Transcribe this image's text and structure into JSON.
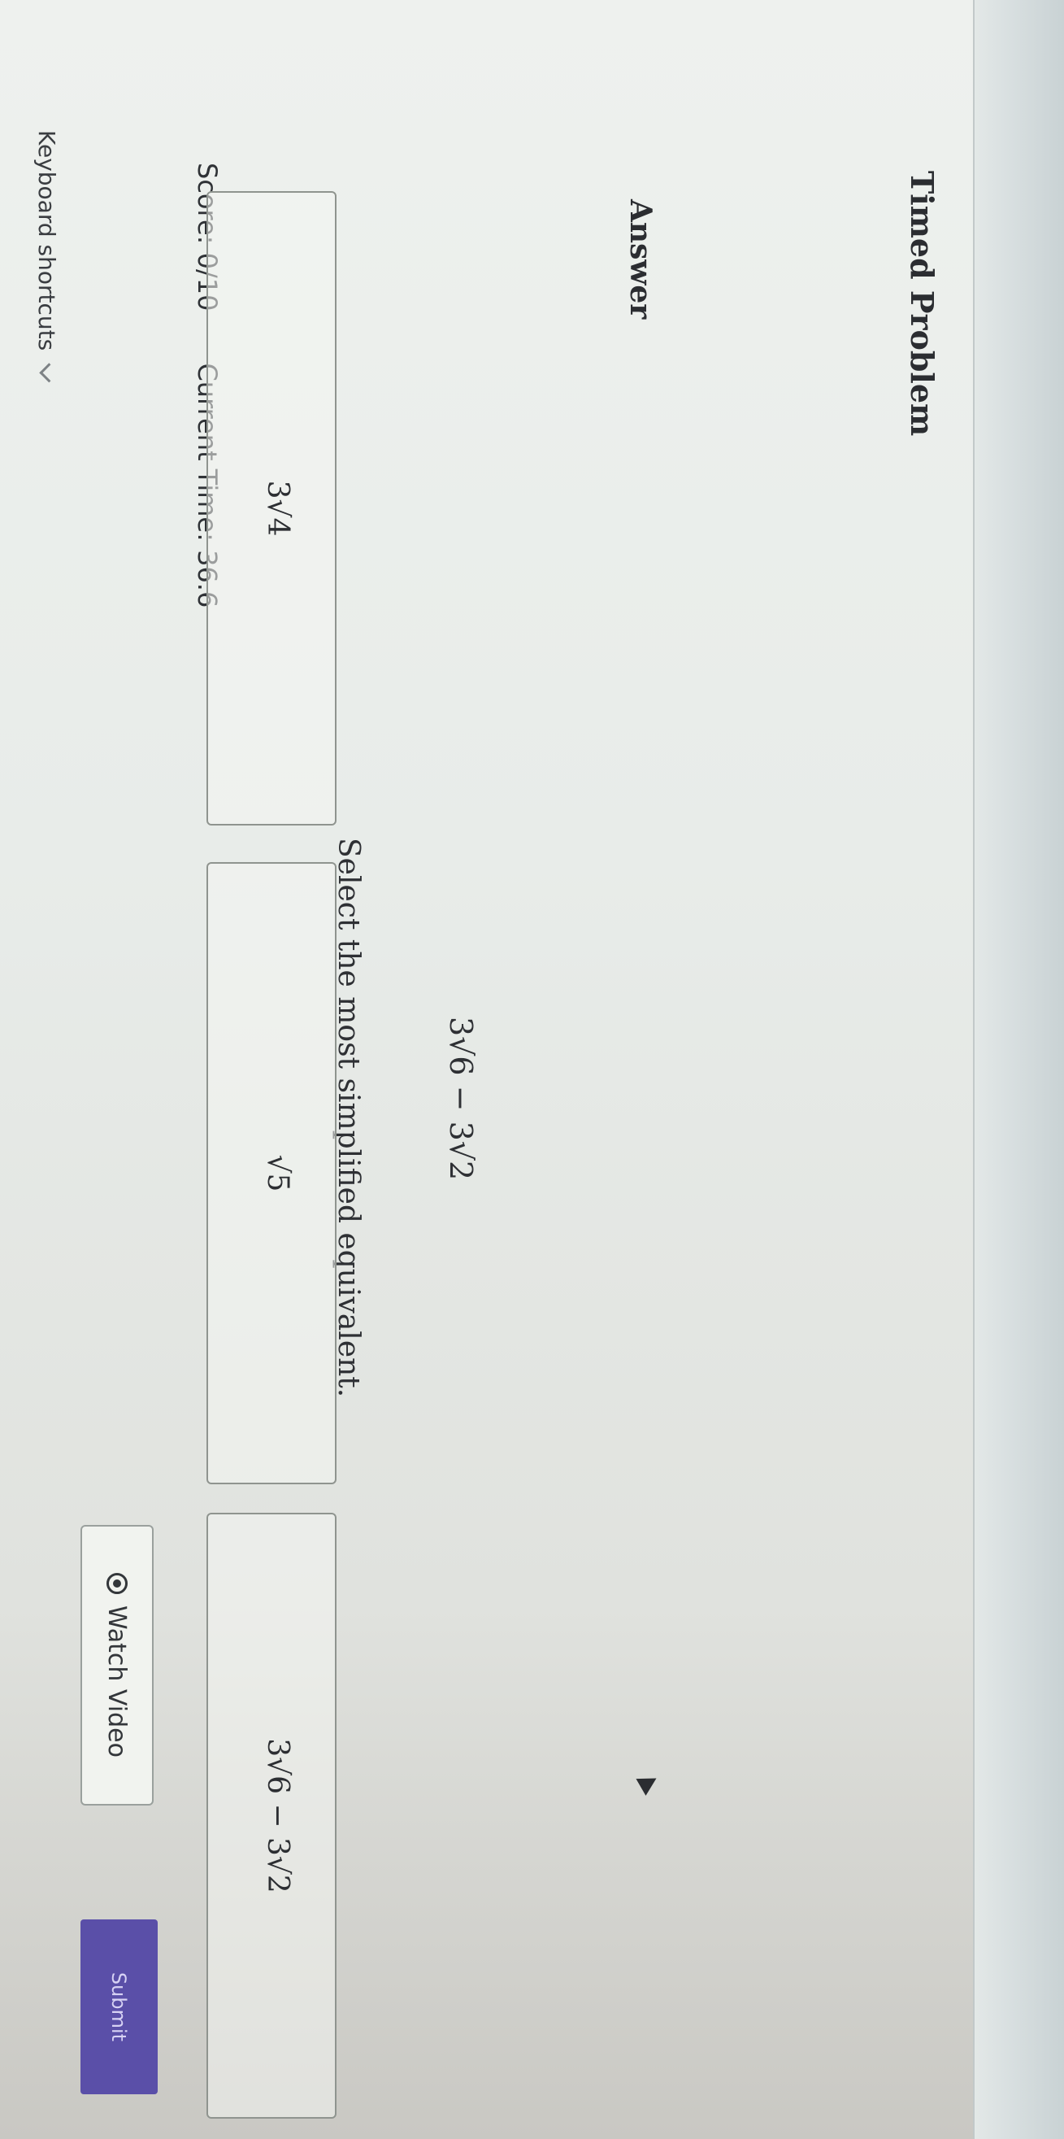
{
  "header": {
    "title": "Timed Problem",
    "watch_video_label": "Watch Video",
    "submit_label": "Submit"
  },
  "status": {
    "score": "Score: 0/10",
    "current_time": "Current Time: 36.6"
  },
  "question": {
    "prompt": "Select the most simplified equivalent.",
    "expression": "3√6 − 3√2"
  },
  "answer": {
    "label": "Answer",
    "choices": [
      {
        "text": "3√4"
      },
      {
        "text": "√5"
      },
      {
        "text": "3√6 − 3√2"
      }
    ]
  },
  "footer": {
    "keyboard_shortcuts": "Keyboard shortcuts"
  },
  "icons": {
    "watch_video": "play-circle-icon",
    "keyboard": "chevron-down-icon"
  },
  "colors": {
    "submit_bg": "#5a4fa8",
    "page_bg": "#e6ebe8"
  }
}
